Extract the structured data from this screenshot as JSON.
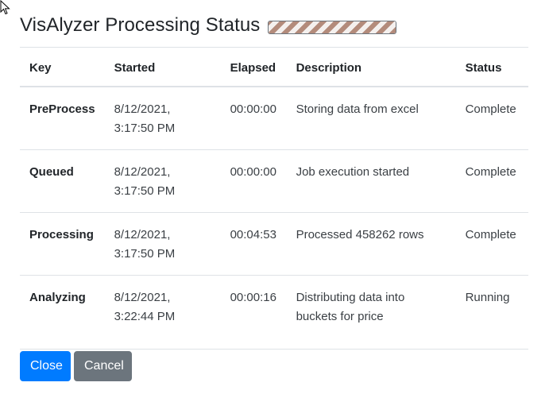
{
  "header": {
    "title": "VisAlyzer Processing Status",
    "progress_percent": 100
  },
  "table": {
    "columns": [
      "Key",
      "Started",
      "Elapsed",
      "Description",
      "Status"
    ],
    "rows": [
      {
        "key": "PreProcess",
        "started_date": "8/12/2021,",
        "started_time": "3:17:50 PM",
        "elapsed": "00:00:00",
        "description": "Storing data from excel",
        "status": "Complete"
      },
      {
        "key": "Queued",
        "started_date": "8/12/2021,",
        "started_time": "3:17:50 PM",
        "elapsed": "00:00:00",
        "description": "Job execution started",
        "status": "Complete"
      },
      {
        "key": "Processing",
        "started_date": "8/12/2021,",
        "started_time": "3:17:50 PM",
        "elapsed": "00:04:53",
        "description": "Processed 458262 rows",
        "status": "Complete"
      },
      {
        "key": "Analyzing",
        "started_date": "8/12/2021,",
        "started_time": "3:22:44 PM",
        "elapsed": "00:00:16",
        "description": "Distributing data into buckets for price",
        "status": "Running"
      }
    ]
  },
  "buttons": {
    "close_label": "Close",
    "cancel_label": "Cancel"
  },
  "colors": {
    "primary": "#007bff",
    "secondary": "#6c757d",
    "progress_stripe": "#b38b7b"
  }
}
